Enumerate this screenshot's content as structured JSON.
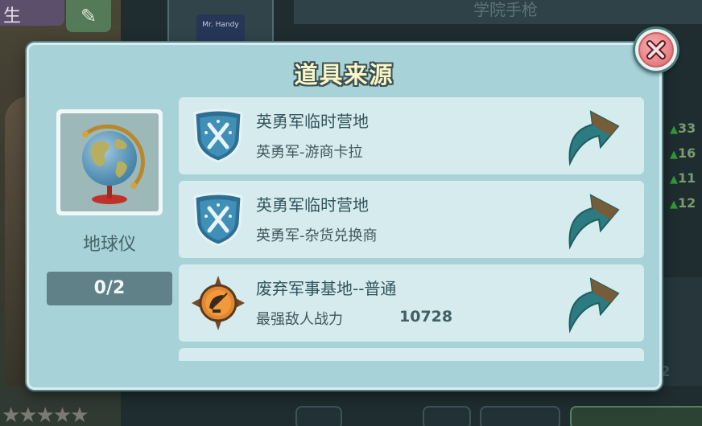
{
  "background": {
    "left_tab_label": "生",
    "header_title": "学院手枪",
    "item_box_label": "Mr. Handy",
    "stats": [
      "33",
      "16",
      "11",
      "12"
    ],
    "right_number": "2",
    "rating_stars": "★★★★★"
  },
  "modal": {
    "title": "道具来源",
    "close_icon": "close-icon",
    "item": {
      "name": "地球仪",
      "icon": "globe-icon",
      "count": "0/2"
    },
    "sources": [
      {
        "icon": "shield-crossed-tools-icon",
        "title": "英勇军临时营地",
        "subtitle": "英勇军-游商卡拉",
        "power_value": ""
      },
      {
        "icon": "shield-crossed-tools-icon",
        "title": "英勇军临时营地",
        "subtitle": "英勇军-杂货兑换商",
        "power_value": ""
      },
      {
        "icon": "radar-dish-compass-icon",
        "title": "废弃军事基地--普通",
        "subtitle": "最强敌人战力",
        "power_value": "10728"
      }
    ],
    "goto_icon": "goto-arrow-icon"
  },
  "colors": {
    "panel": "#a6d2d8",
    "row": "#d6ebee",
    "title_text": "#f9f5c6",
    "close_button": "#e98589",
    "arrow": "#2c7b80"
  }
}
